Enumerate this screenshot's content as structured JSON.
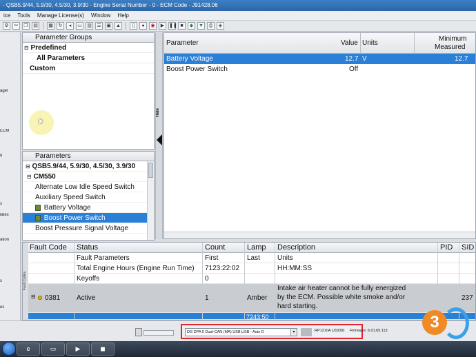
{
  "window": {
    "title": "- QSB5.9/44, 5.9/30, 4.5/30, 3.9/30 - Engine Serial Number - 0 - ECM Code - J91428.06"
  },
  "menu": [
    "ice",
    "Tools",
    "Manage License(s)",
    "Window",
    "Help"
  ],
  "left_nav": [
    "ager",
    "ECM",
    "d",
    "s",
    "lates",
    "ation",
    "s",
    "es"
  ],
  "parameter_groups": {
    "header": "Parameter Groups",
    "items": [
      {
        "label": "Predefined",
        "indent": 0
      },
      {
        "label": "All Parameters",
        "indent": 1
      },
      {
        "label": "Custom",
        "indent": 0
      }
    ]
  },
  "hide_label": "Hide",
  "parameters": {
    "header": "Parameters",
    "root": "QSB5.9/44, 5.9/30, 4.5/30, 3.9/30",
    "group": "CM550",
    "items": [
      {
        "label": "Alternate Low Idle Speed Switch",
        "selected": false,
        "icon": false
      },
      {
        "label": "Auxiliary Speed Switch",
        "selected": false,
        "icon": false
      },
      {
        "label": "Battery Voltage",
        "selected": false,
        "icon": true
      },
      {
        "label": "Boost Power Switch",
        "selected": true,
        "icon": true
      },
      {
        "label": "Boost Pressure Signal Voltage",
        "selected": false,
        "icon": false
      }
    ]
  },
  "param_table": {
    "columns": {
      "parameter": "Parameter",
      "value": "Value",
      "units": "Units",
      "min1": "Minimum",
      "min2": "Measured"
    },
    "rows": [
      {
        "parameter": "Battery Voltage",
        "value": "12.7",
        "units": "V",
        "minimum": "12.7",
        "selected": true
      },
      {
        "parameter": "Boost Power Switch",
        "value": "Off",
        "units": "",
        "minimum": "",
        "selected": false
      }
    ]
  },
  "fault_table": {
    "side_label": "Fault Codes",
    "columns": {
      "code": "Fault Code",
      "status": "Status",
      "count": "Count",
      "lamp": "Lamp",
      "description": "Description",
      "pid": "PID",
      "sid": "SID"
    },
    "sub_rows": [
      {
        "status": "Fault Parameters",
        "count": "First",
        "lamp": "Last",
        "description": "Units"
      },
      {
        "status": "Total Engine Hours (Engine Run Time)",
        "count": "7123:22:02",
        "lamp": "",
        "description": "HH:MM:SS"
      },
      {
        "status": "Keyoffs",
        "count": "0",
        "lamp": "",
        "description": ""
      }
    ],
    "fault": {
      "code": "0381",
      "status": "Active",
      "count": "1",
      "lamp": "Amber",
      "description_lines": [
        "Intake air heater cannot be fully energized",
        "by the ECM.  Possible white smoke and/or",
        "hard starting."
      ],
      "sid": "237"
    },
    "partial_value": "7243:50"
  },
  "statusbar": {
    "adapter": "DG DPA 5 Dual-CAN (MA) USB,USB - Auto D",
    "protocol": "RP1210A (J1939)",
    "firmware": "Firmware: 6.01.65.113"
  },
  "watermark": {
    "text": "3"
  },
  "colors": {
    "selection": "#2a7fd6",
    "highlight_box": "#e0262c",
    "fault_row": "#c9ccd1"
  }
}
